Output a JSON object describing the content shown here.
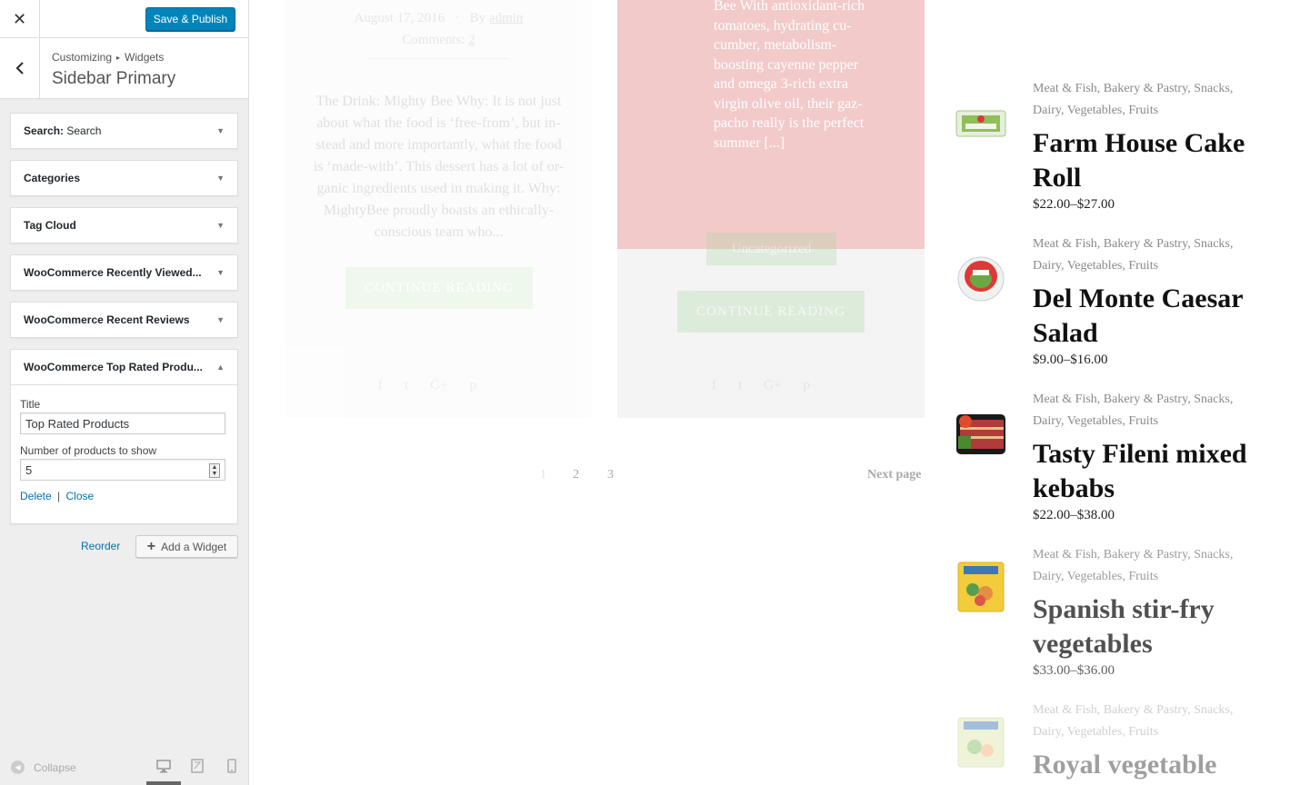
{
  "customizer": {
    "close_glyph": "✕",
    "publish_label": "Save & Publish",
    "back_glyph": "‹",
    "breadcrumb": [
      "Customizing",
      "Widgets"
    ],
    "breadcrumb_sep": "▸",
    "section_title": "Sidebar Primary",
    "widgets": [
      {
        "bold": "Search:",
        "rest": " Search"
      },
      {
        "bold": "Categories",
        "rest": ""
      },
      {
        "bold": "Tag Cloud",
        "rest": ""
      },
      {
        "bold": "WooCommerce Recently Viewed...",
        "rest": ""
      },
      {
        "bold": "WooCommerce Recent Reviews",
        "rest": ""
      },
      {
        "bold": "WooCommerce Top Rated Produ...",
        "rest": ""
      }
    ],
    "collapsed_arrow": "▼",
    "expanded_arrow": "▲",
    "expanded_widget": {
      "title_label": "Title",
      "title_value": "Top Rated Products",
      "number_label": "Number of products to show",
      "number_value": "5",
      "delete_label": "Delete",
      "action_sep": "|",
      "close_label": "Close"
    },
    "reorder_label": "Reorder",
    "add_widget_label": "Add a Widget",
    "add_widget_glyph": "+",
    "collapse_label": "Collapse",
    "collapse_glyph": "◀"
  },
  "preview": {
    "post1": {
      "date": "August 17, 2016",
      "by": "By",
      "author": "admin",
      "comments_label": "Comments:",
      "comments_count": "2",
      "excerpt": "The Drink: Mighty Bee Why: It is not just about what the food is ‘free-from’, but in-stead and more importantly, what the food is ‘made-with’. This dessert has a lot of or-ganic ingredients used in making it. Why: MightyBee proudly boasts an ethically-conscious team who...",
      "button": "CONTINUE READING",
      "share_icons": [
        "f",
        "t",
        "G+",
        "p"
      ]
    },
    "post2": {
      "excerpt": "Bee With antioxidant-rich tomatoes, hydrating cu-cumber, metabolism-boosting cayenne pepper and omega 3-rich extra virgin olive oil, their gaz-pacho really is the perfect summer [...]",
      "category": "Uncategorized",
      "button": "CONTINUE READING",
      "share_icons": [
        "f",
        "t",
        "G+",
        "p"
      ]
    },
    "pagination": {
      "pages": [
        "1",
        "2",
        "3"
      ],
      "next": "Next page"
    },
    "products": [
      {
        "cats": "Meat & Fish, Bakery & Pastry, Snacks, Dairy, Vegetables, Fruits",
        "title": "Farm House Cake Roll",
        "price": "$22.00–$27.00",
        "image": "cake-roll-package"
      },
      {
        "cats": "Meat & Fish, Bakery & Pastry, Snacks, Dairy, Vegetables, Fruits",
        "title": "Del Monte Caesar Salad",
        "price": "$9.00–$16.00",
        "image": "salad-bowl"
      },
      {
        "cats": "Meat & Fish, Bakery & Pastry, Snacks, Dairy, Vegetables, Fruits",
        "title": "Tasty Fileni mixed kebabs",
        "price": "$22.00–$38.00",
        "image": "kebab-tray"
      },
      {
        "cats": "Meat & Fish, Bakery & Pastry, Snacks, Dairy, Vegetables, Fruits",
        "title": "Spanish stir-fry vegetables",
        "price": "$33.00–$36.00",
        "image": "vegetable-bag"
      },
      {
        "cats": "Meat & Fish, Bakery & Pastry, Snacks, Dairy, Vegetables, Fruits",
        "title": "Royal vegetable",
        "price": "",
        "image": "vegetable-bag"
      }
    ]
  }
}
